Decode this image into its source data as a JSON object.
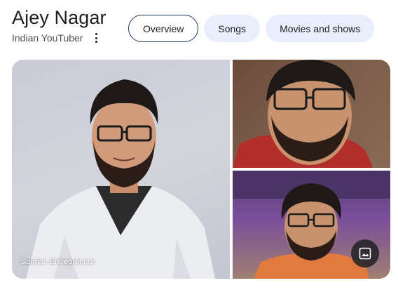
{
  "header": {
    "title": "Ajey Nagar",
    "subtitle": "Indian YouTuber",
    "more_icon": "more-vert-icon"
  },
  "chips": [
    {
      "label": "Overview",
      "selected": true
    },
    {
      "label": "Songs",
      "selected": false
    },
    {
      "label": "Movies and shows",
      "selected": false
    }
  ],
  "gallery": {
    "main_source": "Source: Entrepreneur",
    "images_icon": "image-icon"
  },
  "colors": {
    "chip_bg": "#e8eefc",
    "chip_selected_border": "#1f3a5f",
    "title_text": "#1f1f1f",
    "subtitle_text": "#4d5156"
  }
}
